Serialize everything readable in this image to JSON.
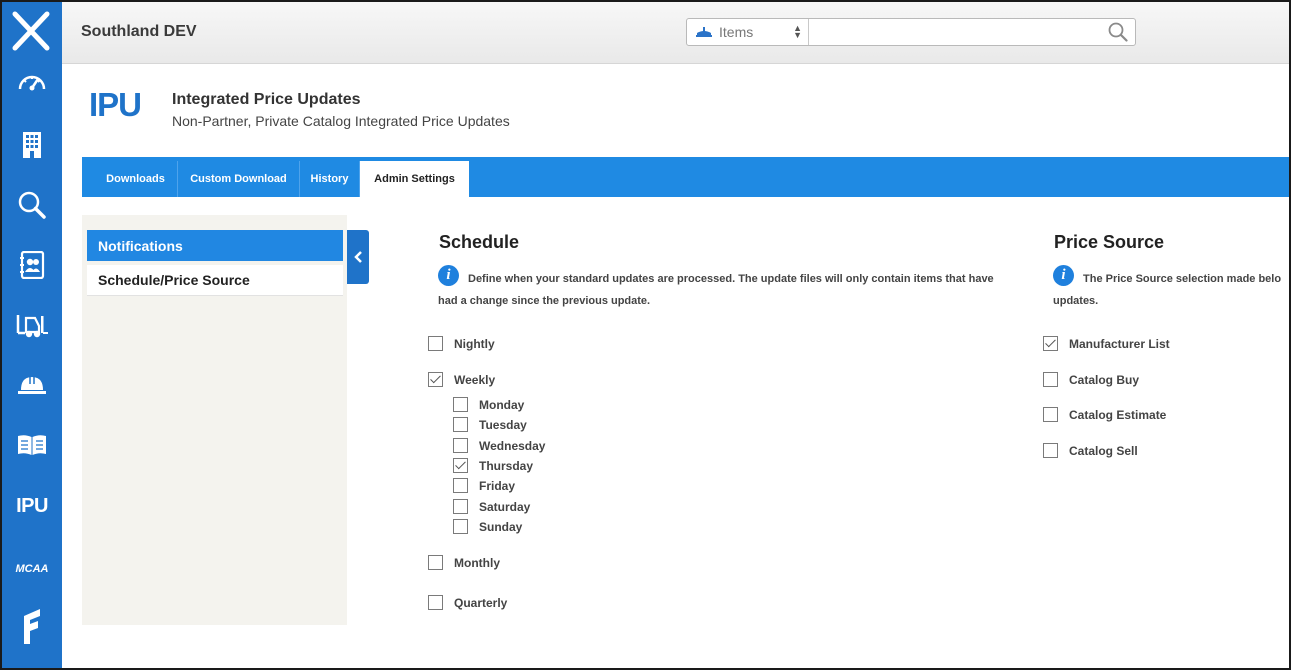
{
  "nav": {
    "items": [
      {
        "name": "dashboard-gauge-icon"
      },
      {
        "name": "building-icon"
      },
      {
        "name": "search-icon"
      },
      {
        "name": "contacts-icon"
      },
      {
        "name": "forklift-icon"
      },
      {
        "name": "hard-hat-icon"
      },
      {
        "name": "book-icon"
      },
      {
        "name": "ipu-nav",
        "label": "IPU"
      },
      {
        "name": "mcaa-nav",
        "label": "MCAA"
      },
      {
        "name": "f-logo-icon"
      }
    ]
  },
  "topbar": {
    "company": "Southland DEV",
    "search_type": "Items",
    "search_placeholder": ""
  },
  "header": {
    "logo": "IPU",
    "title": "Integrated Price Updates",
    "subtitle": "Non-Partner, Private Catalog Integrated Price Updates"
  },
  "tabs": [
    {
      "label": "Downloads",
      "active": false
    },
    {
      "label": "Custom Download",
      "active": false
    },
    {
      "label": "History",
      "active": false
    },
    {
      "label": "Admin Settings",
      "active": true
    }
  ],
  "sidebar": {
    "items": [
      {
        "label": "Notifications",
        "active": true
      },
      {
        "label": "Schedule/Price Source",
        "active": false
      }
    ]
  },
  "schedule": {
    "title": "Schedule",
    "info": "Define when your standard updates are processed. The update files will only contain items that have",
    "info_line2": "had a change since the previous update.",
    "options": [
      {
        "label": "Nightly",
        "checked": false
      },
      {
        "label": "Weekly",
        "checked": true
      },
      {
        "label": "Monthly",
        "checked": false
      },
      {
        "label": "Quarterly",
        "checked": false
      }
    ],
    "days": [
      {
        "label": "Monday",
        "checked": false
      },
      {
        "label": "Tuesday",
        "checked": false
      },
      {
        "label": "Wednesday",
        "checked": false
      },
      {
        "label": "Thursday",
        "checked": true
      },
      {
        "label": "Friday",
        "checked": false
      },
      {
        "label": "Saturday",
        "checked": false
      },
      {
        "label": "Sunday",
        "checked": false
      }
    ]
  },
  "price_source": {
    "title": "Price Source",
    "info": "The Price Source selection made belo",
    "info_line2": "updates.",
    "options": [
      {
        "label": "Manufacturer List",
        "checked": true
      },
      {
        "label": "Catalog Buy",
        "checked": false
      },
      {
        "label": "Catalog Estimate",
        "checked": false
      },
      {
        "label": "Catalog Sell",
        "checked": false
      }
    ]
  },
  "colors": {
    "nav_blue": "#1f73c9",
    "tab_blue": "#1f8ae3",
    "active_item": "#2187e2"
  }
}
